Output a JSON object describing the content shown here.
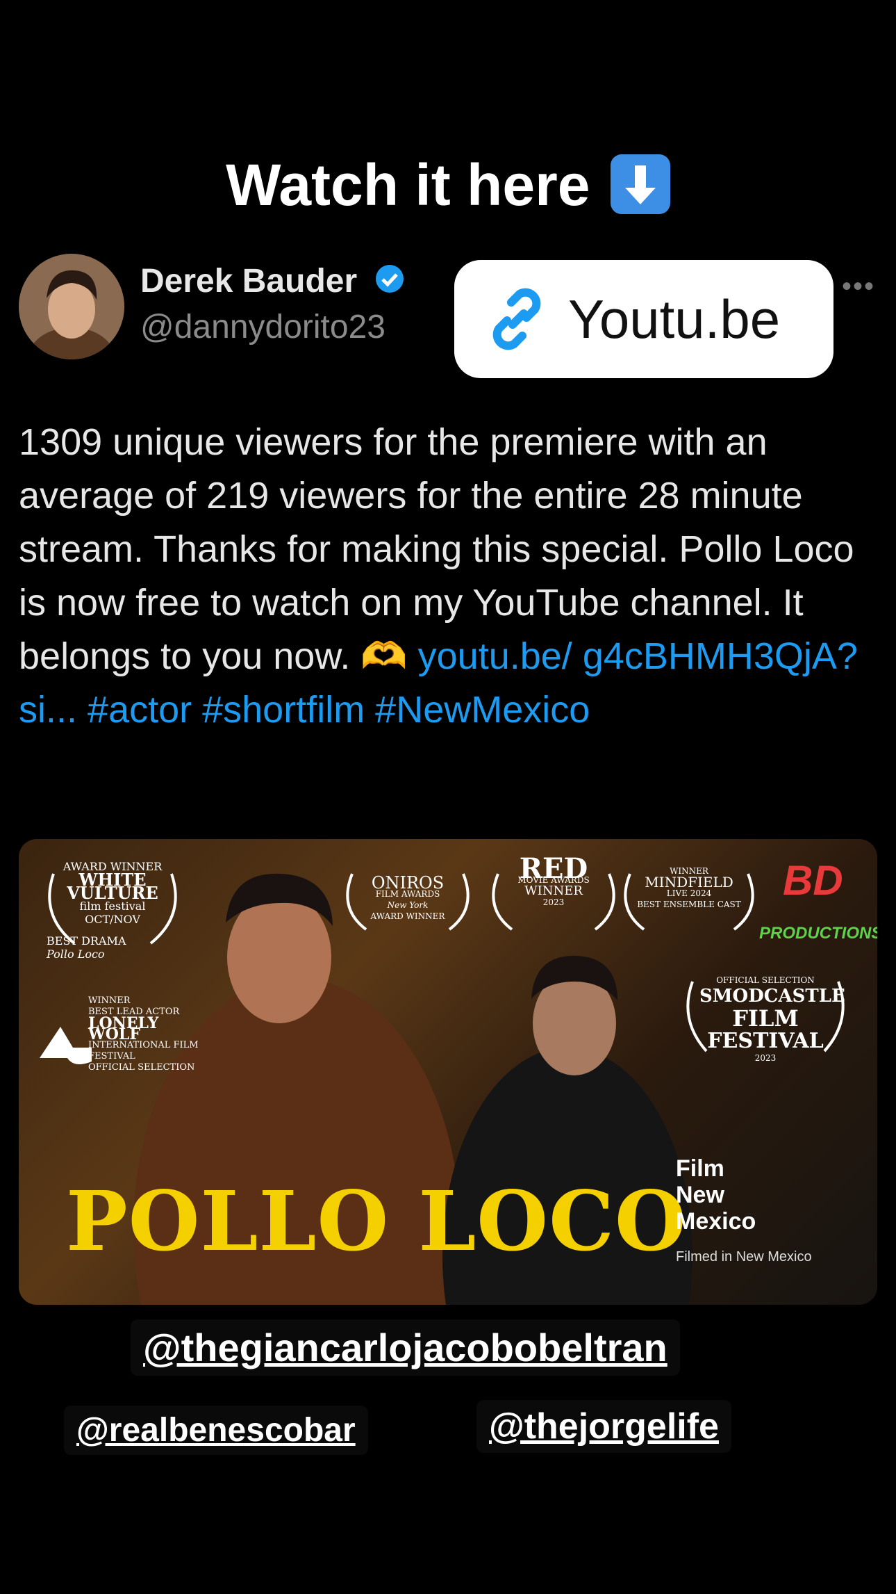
{
  "story": {
    "headline": "Watch it here",
    "headline_emoji": "arrow-down-icon",
    "mentions": [
      "@thegiancarlojacobobeltran",
      "@realbenescobar",
      "@thejorgelife"
    ]
  },
  "tweet": {
    "author_name": "Derek Bauder",
    "author_handle": "@dannydorito23",
    "verified": true,
    "text_main": "1309 unique viewers for the premiere with an average of 219 viewers for the entire 28 minute stream. Thanks for making this special. Pollo Loco is now free to watch on my YouTube channel. It belongs to you now.",
    "link_text": "youtu.be/ g4cBHMH3QjA?si...",
    "hashtags": "#actor #shortfilm #NewMexico"
  },
  "link_sticker": {
    "label": "Youtu.be",
    "icon": "link-icon"
  },
  "poster": {
    "title": "POLLO LOCO",
    "awards": {
      "white_vulture": [
        "AWARD WINNER",
        "WHITE",
        "VULTURE",
        "film festival",
        "OCT/NOV",
        "BEST DRAMA",
        "Pollo Loco"
      ],
      "lonely_wolf": [
        "WINNER",
        "BEST LEAD ACTOR",
        "LONELY WOLF",
        "INTERNATIONAL FILM FESTIVAL",
        "OFFICIAL SELECTION"
      ],
      "oniros": [
        "ONIROS",
        "FILM AWARDS",
        "New York",
        "AWARD WINNER"
      ],
      "red_movie": [
        "RED",
        "MOVIE AWARDS",
        "WINNER",
        "2023"
      ],
      "mindfield": [
        "WINNER",
        "MINDFIELD",
        "LIVE",
        "2024",
        "BEST ENSEMBLE CAST"
      ],
      "smodcastle": [
        "OFFICIAL SELECTION",
        "SMODCASTLE",
        "FILM",
        "FESTIVAL",
        "2023"
      ]
    },
    "brand": "BD",
    "brand_sub": "PRODUCTIONS",
    "film_nm": [
      "Film",
      "New",
      "Mexico"
    ],
    "film_nm_sub": "Filmed in New Mexico"
  },
  "colors": {
    "link": "#1d9bf0",
    "title": "#f5d000",
    "background": "#000000"
  }
}
